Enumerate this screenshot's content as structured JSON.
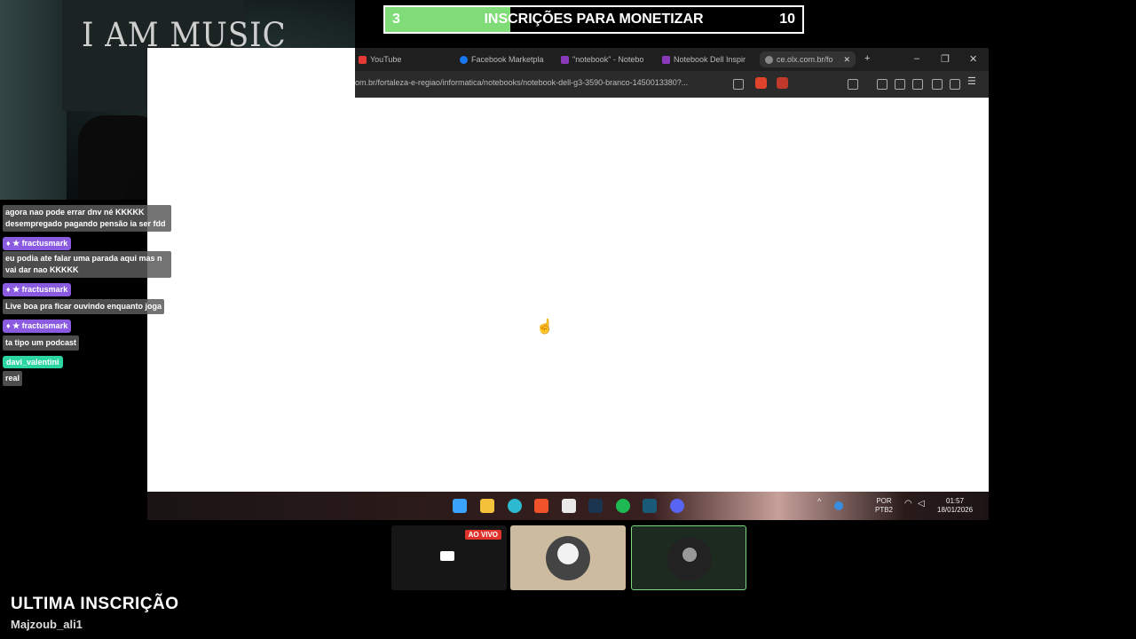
{
  "webcam": {
    "poster_text": "I AM MUSIC"
  },
  "goal": {
    "current": "3",
    "title": "INSCRIÇÕES PARA MONETIZAR",
    "target": "10",
    "progress": 0.3,
    "fill_color": "#7fdc76"
  },
  "browser": {
    "tabs": [
      {
        "label": "YouTube",
        "icon": "youtube-icon",
        "color": "#e53935"
      },
      {
        "label": "Facebook Marketpla",
        "icon": "facebook-icon",
        "color": "#1877f2"
      },
      {
        "label": "\"notebook\" - Notebo",
        "icon": "olx-icon",
        "color": "#8a3ab9"
      },
      {
        "label": "Notebook Dell Inspir",
        "icon": "olx-icon",
        "color": "#8a3ab9"
      },
      {
        "label": "ce.olx.com.br/fo",
        "icon": "globe-icon",
        "color": "#888888",
        "active": true
      }
    ],
    "new_tab_label": "+",
    "url": "om.br/fortaleza-e-regiao/informatica/notebooks/notebook-dell-g3-3590-branco-1450013380?..."
  },
  "taskbar": {
    "language": "POR",
    "layout": "PTB2",
    "time": "01:57",
    "date": "18/01/2026",
    "icons": [
      "windows-start-icon",
      "file-explorer-icon",
      "edge-icon",
      "brave-icon",
      "store-icon",
      "steam-icon",
      "spotify-icon",
      "vegas-icon",
      "discord-icon"
    ]
  },
  "chat": {
    "messages": [
      {
        "user": "fractusmark",
        "text": "agora nao pode errar dnv né KKKKK desempregado pagando pensão ia ser fdd",
        "user_color": "#8a5be0",
        "hide_user": true
      },
      {
        "user": "fractusmark",
        "text": "eu podia ate falar uma parada aqui mas n vai dar nao KKKKK",
        "user_color": "#8a5be0"
      },
      {
        "user": "fractusmark",
        "text": "Live boa pra ficar ouvindo enquanto joga",
        "user_color": "#8a5be0"
      },
      {
        "user": "fractusmark",
        "text": "ta tipo um podcast",
        "user_color": "#8a5be0"
      },
      {
        "user": "davi_valentini",
        "text": "real",
        "user_color": "#2bd6a3"
      }
    ]
  },
  "participants": {
    "live_badge": "AO VIVO"
  },
  "last_subscriber": {
    "title": "ULTIMA INSCRIÇÃO",
    "name": "Majzoub_ali1"
  }
}
